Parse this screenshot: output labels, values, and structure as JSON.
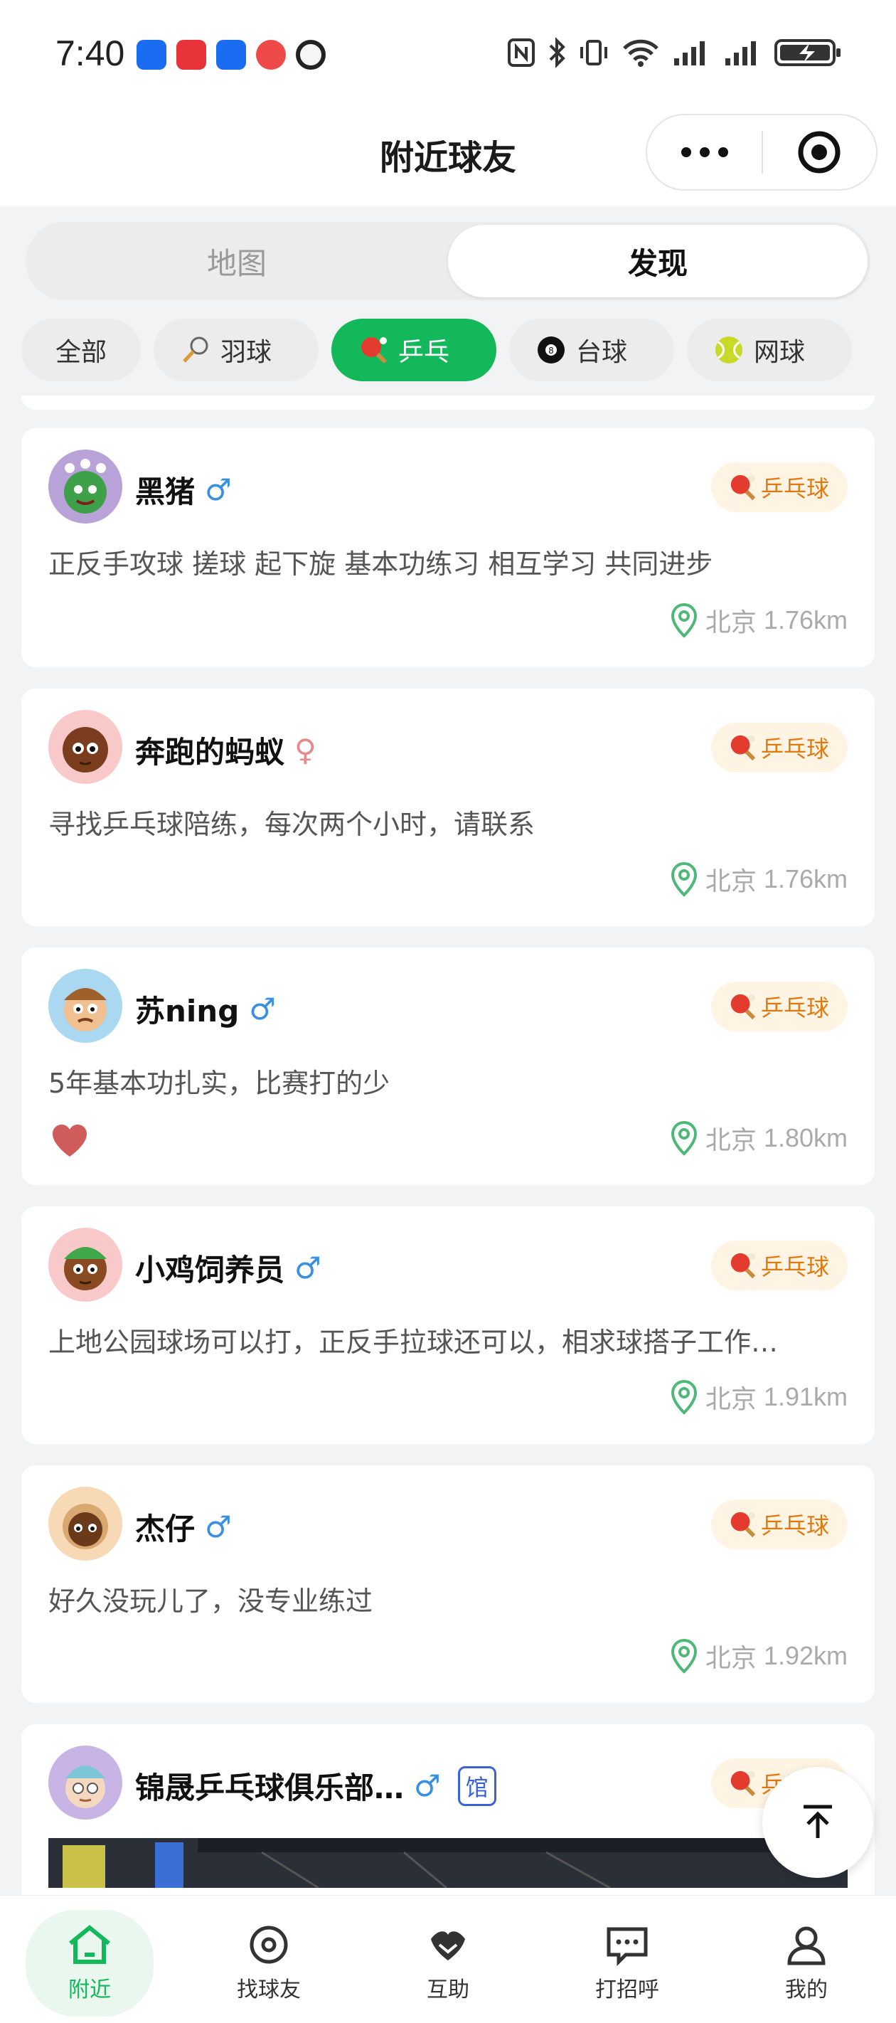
{
  "status_bar": {
    "time": "7:40",
    "battery_icon": "battery-charging-icon"
  },
  "header": {
    "title": "附近球友",
    "more_icon": "more-dots-icon",
    "target_icon": "target-icon"
  },
  "segment": {
    "items": [
      "地图",
      "发现"
    ],
    "active": "发现"
  },
  "sports": [
    {
      "label": "全部",
      "icon": ""
    },
    {
      "label": "羽球",
      "icon": "badminton-icon"
    },
    {
      "label": "乒乓",
      "icon": "ping-pong-icon"
    },
    {
      "label": "台球",
      "icon": "billiards-icon"
    },
    {
      "label": "网球",
      "icon": "tennis-icon"
    }
  ],
  "active_sport": "乒乓",
  "colors": {
    "brand_green": "#12b85a",
    "tag_bg": "#fff3e3",
    "tag_text": "#e07a10",
    "male": "#3a8fe0",
    "female": "#e48a8a"
  },
  "posts": [
    {
      "name": "黑猪",
      "gender": "♂",
      "tag": "乒乓球",
      "desc": "正反手攻球 搓球 起下旋 基本功练习 相互学习 共同进步",
      "city": "北京",
      "distance": "1.76km"
    },
    {
      "name": "奔跑的蚂蚁",
      "gender": "♀",
      "tag": "乒乓球",
      "desc": "寻找乒乓球陪练，每次两个小时，请联系",
      "city": "北京",
      "distance": "1.76km"
    },
    {
      "name": "苏ning",
      "gender": "♂",
      "tag": "乒乓球",
      "desc": "5年基本功扎实，比赛打的少",
      "city": "北京",
      "distance": "1.80km"
    },
    {
      "name": "小鸡饲养员",
      "gender": "♂",
      "tag": "乒乓球",
      "desc": "上地公园球场可以打，正反手拉球还可以，相求球搭子工作…",
      "city": "北京",
      "distance": "1.91km"
    },
    {
      "name": "杰仔",
      "gender": "♂",
      "tag": "乒乓球",
      "desc": "好久没玩儿了，没专业练过",
      "city": "北京",
      "distance": "1.92km"
    },
    {
      "name": "锦晟乒乓球俱乐部…",
      "gender": "♂",
      "badge": "馆",
      "tag": "乒乓球"
    }
  ],
  "tabbar": [
    {
      "label": "附近",
      "icon": "home-icon"
    },
    {
      "label": "找球友",
      "icon": "location-pin-icon"
    },
    {
      "label": "互助",
      "icon": "handshake-icon"
    },
    {
      "label": "打招呼",
      "icon": "chat-icon"
    },
    {
      "label": "我的",
      "icon": "user-icon"
    }
  ]
}
